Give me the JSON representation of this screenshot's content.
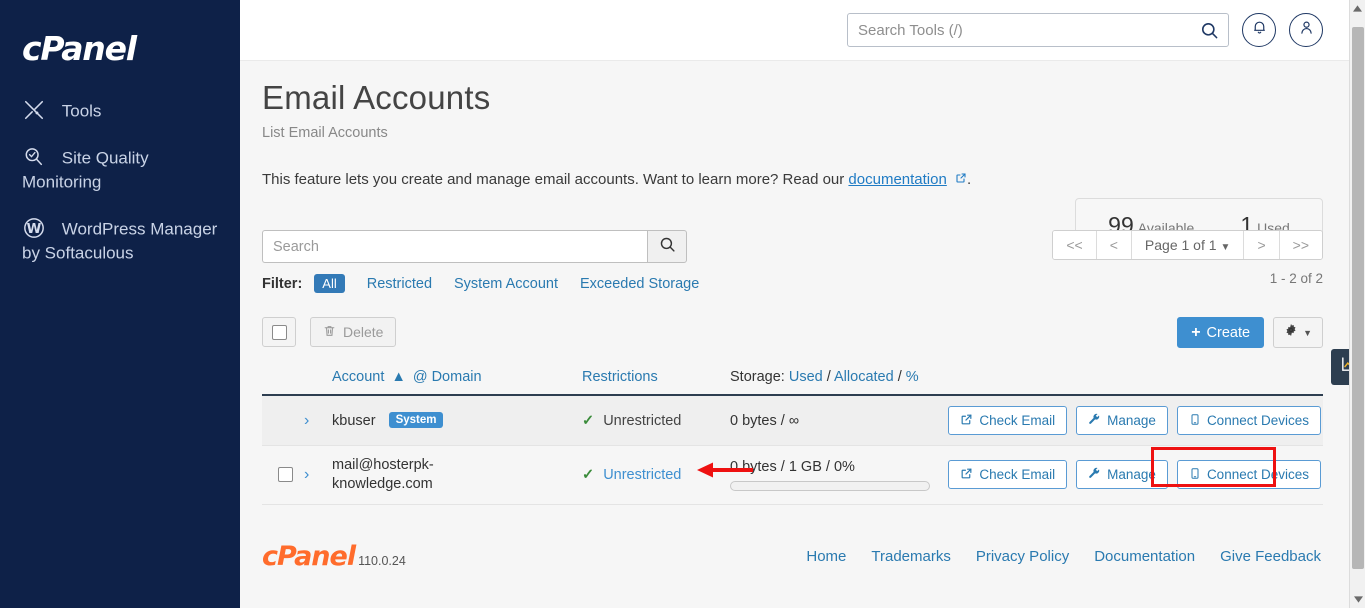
{
  "sidebar": {
    "brand": "cPanel",
    "items": [
      {
        "label": "Tools",
        "icon": "tools-icon"
      },
      {
        "label": "Site Quality Monitoring",
        "icon": "site-quality-icon"
      },
      {
        "label": "WordPress Manager by Softaculous",
        "icon": "wordpress-icon"
      }
    ]
  },
  "header": {
    "search_placeholder": "Search Tools (/)",
    "search_value": "",
    "search_icon": "search-icon",
    "notifications_icon": "bell-icon",
    "account_icon": "user-icon"
  },
  "page": {
    "title": "Email Accounts",
    "subtitle": "List Email Accounts",
    "description_pre": "This feature lets you create and manage email accounts. Want to learn more? Read our ",
    "description_link": "documentation",
    "description_post": "."
  },
  "stats": {
    "available_value": "99",
    "available_label": "Available",
    "used_value": "1",
    "used_label": "Used"
  },
  "toolbar": {
    "search_placeholder": "Search",
    "search_value": "",
    "filter_label": "Filter:",
    "filters": [
      {
        "label": "All",
        "active": true
      },
      {
        "label": "Restricted",
        "active": false
      },
      {
        "label": "System Account",
        "active": false
      },
      {
        "label": "Exceeded Storage",
        "active": false
      }
    ],
    "delete_label": "Delete",
    "create_label": "Create",
    "settings_icon": "gear-icon"
  },
  "pagination": {
    "first_label": "<<",
    "prev_label": "<",
    "current_label": "Page 1 of 1",
    "next_label": ">",
    "last_label": ">>",
    "count_label": "1 - 2 of 2"
  },
  "table": {
    "columns": {
      "account": "Account",
      "at_domain": "@ Domain",
      "sort_icon": "sort-asc-icon",
      "restrictions": "Restrictions",
      "storage_prefix": "Storage:",
      "storage_used": "Used",
      "storage_sep1": "/",
      "storage_allocated": "Allocated",
      "storage_sep2": "/",
      "storage_percent": "%"
    },
    "rows": [
      {
        "account": "kbuser",
        "badge": "System",
        "has_checkbox": false,
        "restriction": "Unrestricted",
        "restriction_is_link": false,
        "storage": "0 bytes / ∞",
        "has_progress": false,
        "actions": [
          {
            "label": "Check Email",
            "icon": "external-link-icon"
          },
          {
            "label": "Manage",
            "icon": "wrench-icon"
          },
          {
            "label": "Connect Devices",
            "icon": "mobile-icon"
          }
        ]
      },
      {
        "account": "mail@hosterpk-knowledge.com",
        "badge": "",
        "has_checkbox": true,
        "restriction": "Unrestricted",
        "restriction_is_link": true,
        "storage": "0 bytes / 1 GB / 0%",
        "has_progress": true,
        "progress_percent": 0,
        "actions": [
          {
            "label": "Check Email",
            "icon": "external-link-icon"
          },
          {
            "label": "Manage",
            "icon": "wrench-icon"
          },
          {
            "label": "Connect Devices",
            "icon": "mobile-icon"
          }
        ]
      }
    ]
  },
  "footer": {
    "brand": "cPanel",
    "version": "110.0.24",
    "links": [
      "Home",
      "Trademarks",
      "Privacy Policy",
      "Documentation",
      "Give Feedback"
    ]
  },
  "stats_tab": {
    "icon": "chart-icon"
  },
  "annotations": {
    "arrow_color": "#ee1111",
    "box_color": "#ee1111"
  },
  "colors": {
    "sidebar_bg": "#0e2148",
    "accent_blue": "#3e8fd0",
    "link_blue": "#2a7ab0",
    "footer_orange": "#ff6c2c",
    "success_green": "#3b8c3b"
  }
}
